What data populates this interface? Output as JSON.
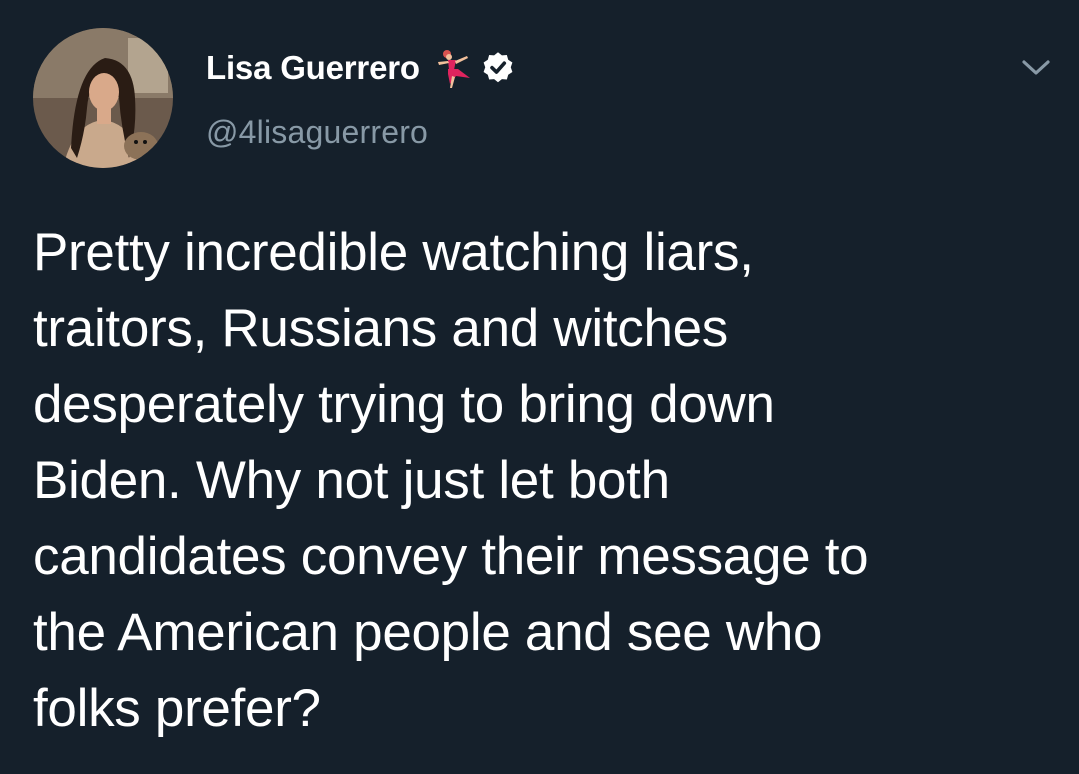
{
  "tweet": {
    "author": {
      "display_name": "Lisa Guerrero",
      "name_emoji": "dancer-icon",
      "verified_badge": "verified-icon",
      "handle": "@4lisaguerrero",
      "avatar": "profile-photo"
    },
    "menu_icon": "chevron-down-icon",
    "text_lines": [
      "Pretty incredible watching liars,",
      "traitors, Russians and witches",
      "desperately trying to bring down",
      "Biden. Why not just let both",
      "candidates convey their message to",
      "the American people and see who",
      "folks prefer?"
    ]
  },
  "colors": {
    "background": "#15202b",
    "primary_text": "#ffffff",
    "secondary_text": "#8899a6"
  }
}
